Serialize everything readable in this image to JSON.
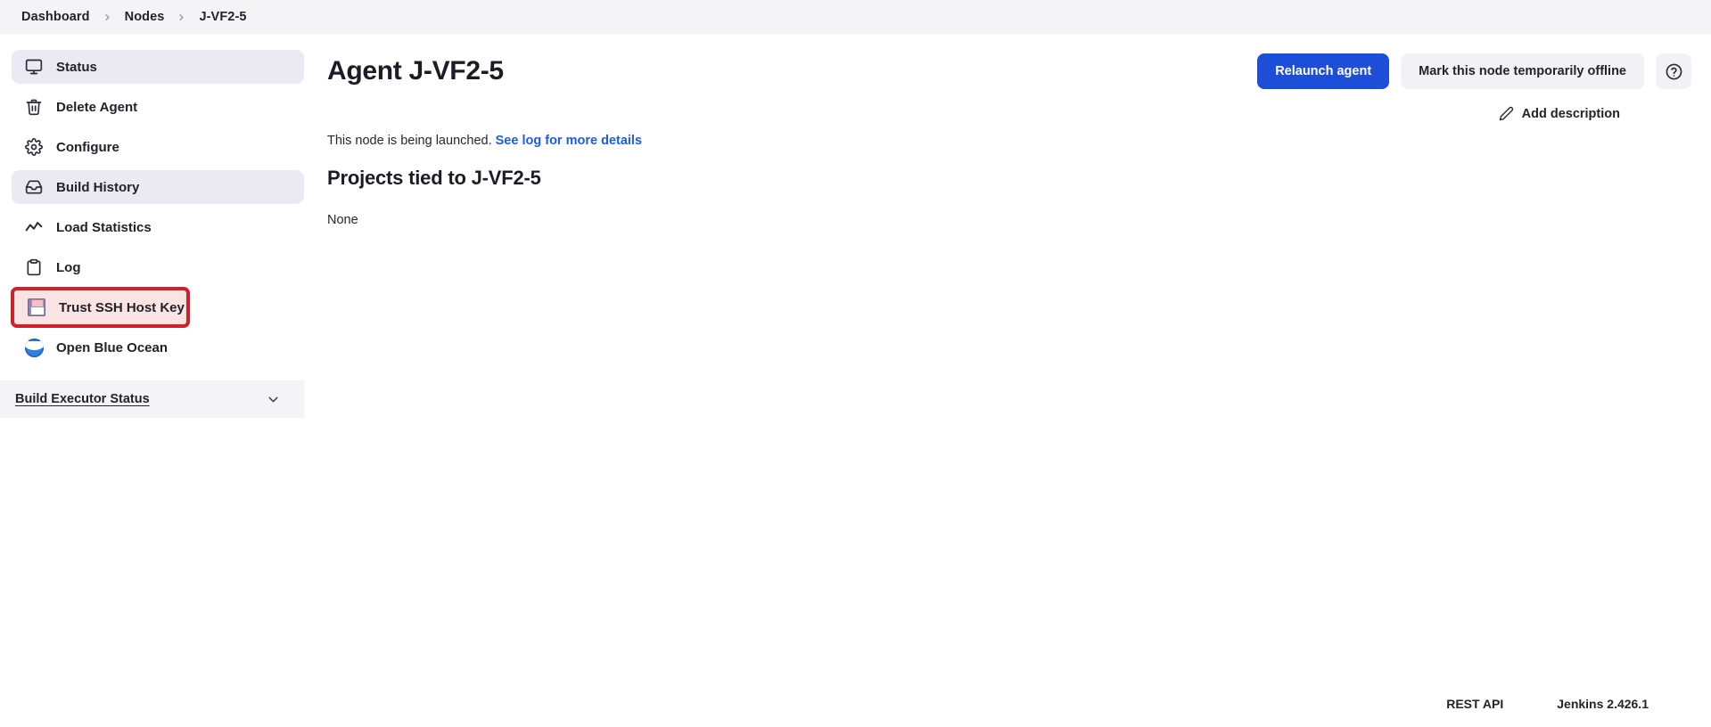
{
  "breadcrumb": {
    "items": [
      {
        "label": "Dashboard"
      },
      {
        "label": "Nodes"
      },
      {
        "label": "J-VF2-5"
      }
    ]
  },
  "sidebar": {
    "items": [
      {
        "label": "Status",
        "icon": "monitor-icon",
        "shaded": true,
        "flagged": false
      },
      {
        "label": "Delete Agent",
        "icon": "trash-icon",
        "shaded": false,
        "flagged": false
      },
      {
        "label": "Configure",
        "icon": "gear-icon",
        "shaded": false,
        "flagged": false
      },
      {
        "label": "Build History",
        "icon": "inbox-icon",
        "shaded": true,
        "flagged": false
      },
      {
        "label": "Load Statistics",
        "icon": "chart-line-icon",
        "shaded": false,
        "flagged": false
      },
      {
        "label": "Log",
        "icon": "clipboard-icon",
        "shaded": false,
        "flagged": false
      },
      {
        "label": "Trust SSH Host Key",
        "icon": "floppy-icon",
        "shaded": false,
        "flagged": true
      },
      {
        "label": "Open Blue Ocean",
        "icon": "blue-ocean-icon",
        "shaded": false,
        "flagged": false
      }
    ],
    "executor_status": {
      "title": "Build Executor Status",
      "chevron": "chevron-down-icon"
    }
  },
  "main": {
    "title": "Agent J-VF2-5",
    "buttons": {
      "relaunch": "Relaunch agent",
      "offline": "Mark this node temporarily offline",
      "help": "help-circle-icon"
    },
    "add_description": {
      "label": "Add description",
      "icon": "pencil-icon"
    },
    "status": {
      "text": "This node is being launched.",
      "link": "See log for more details"
    },
    "projects": {
      "heading": "Projects tied to J-VF2-5",
      "body": "None"
    }
  },
  "footer": {
    "rest_api": "REST API",
    "version": "Jenkins 2.426.1"
  },
  "colors": {
    "accent": "#1d4ed8",
    "link": "#1d5ce0",
    "highlight_border": "#cc2229",
    "highlight_fill": "#fae3e3",
    "sidebar_shade": "#ebeaf2",
    "bar_bg": "#f4f4f7"
  }
}
